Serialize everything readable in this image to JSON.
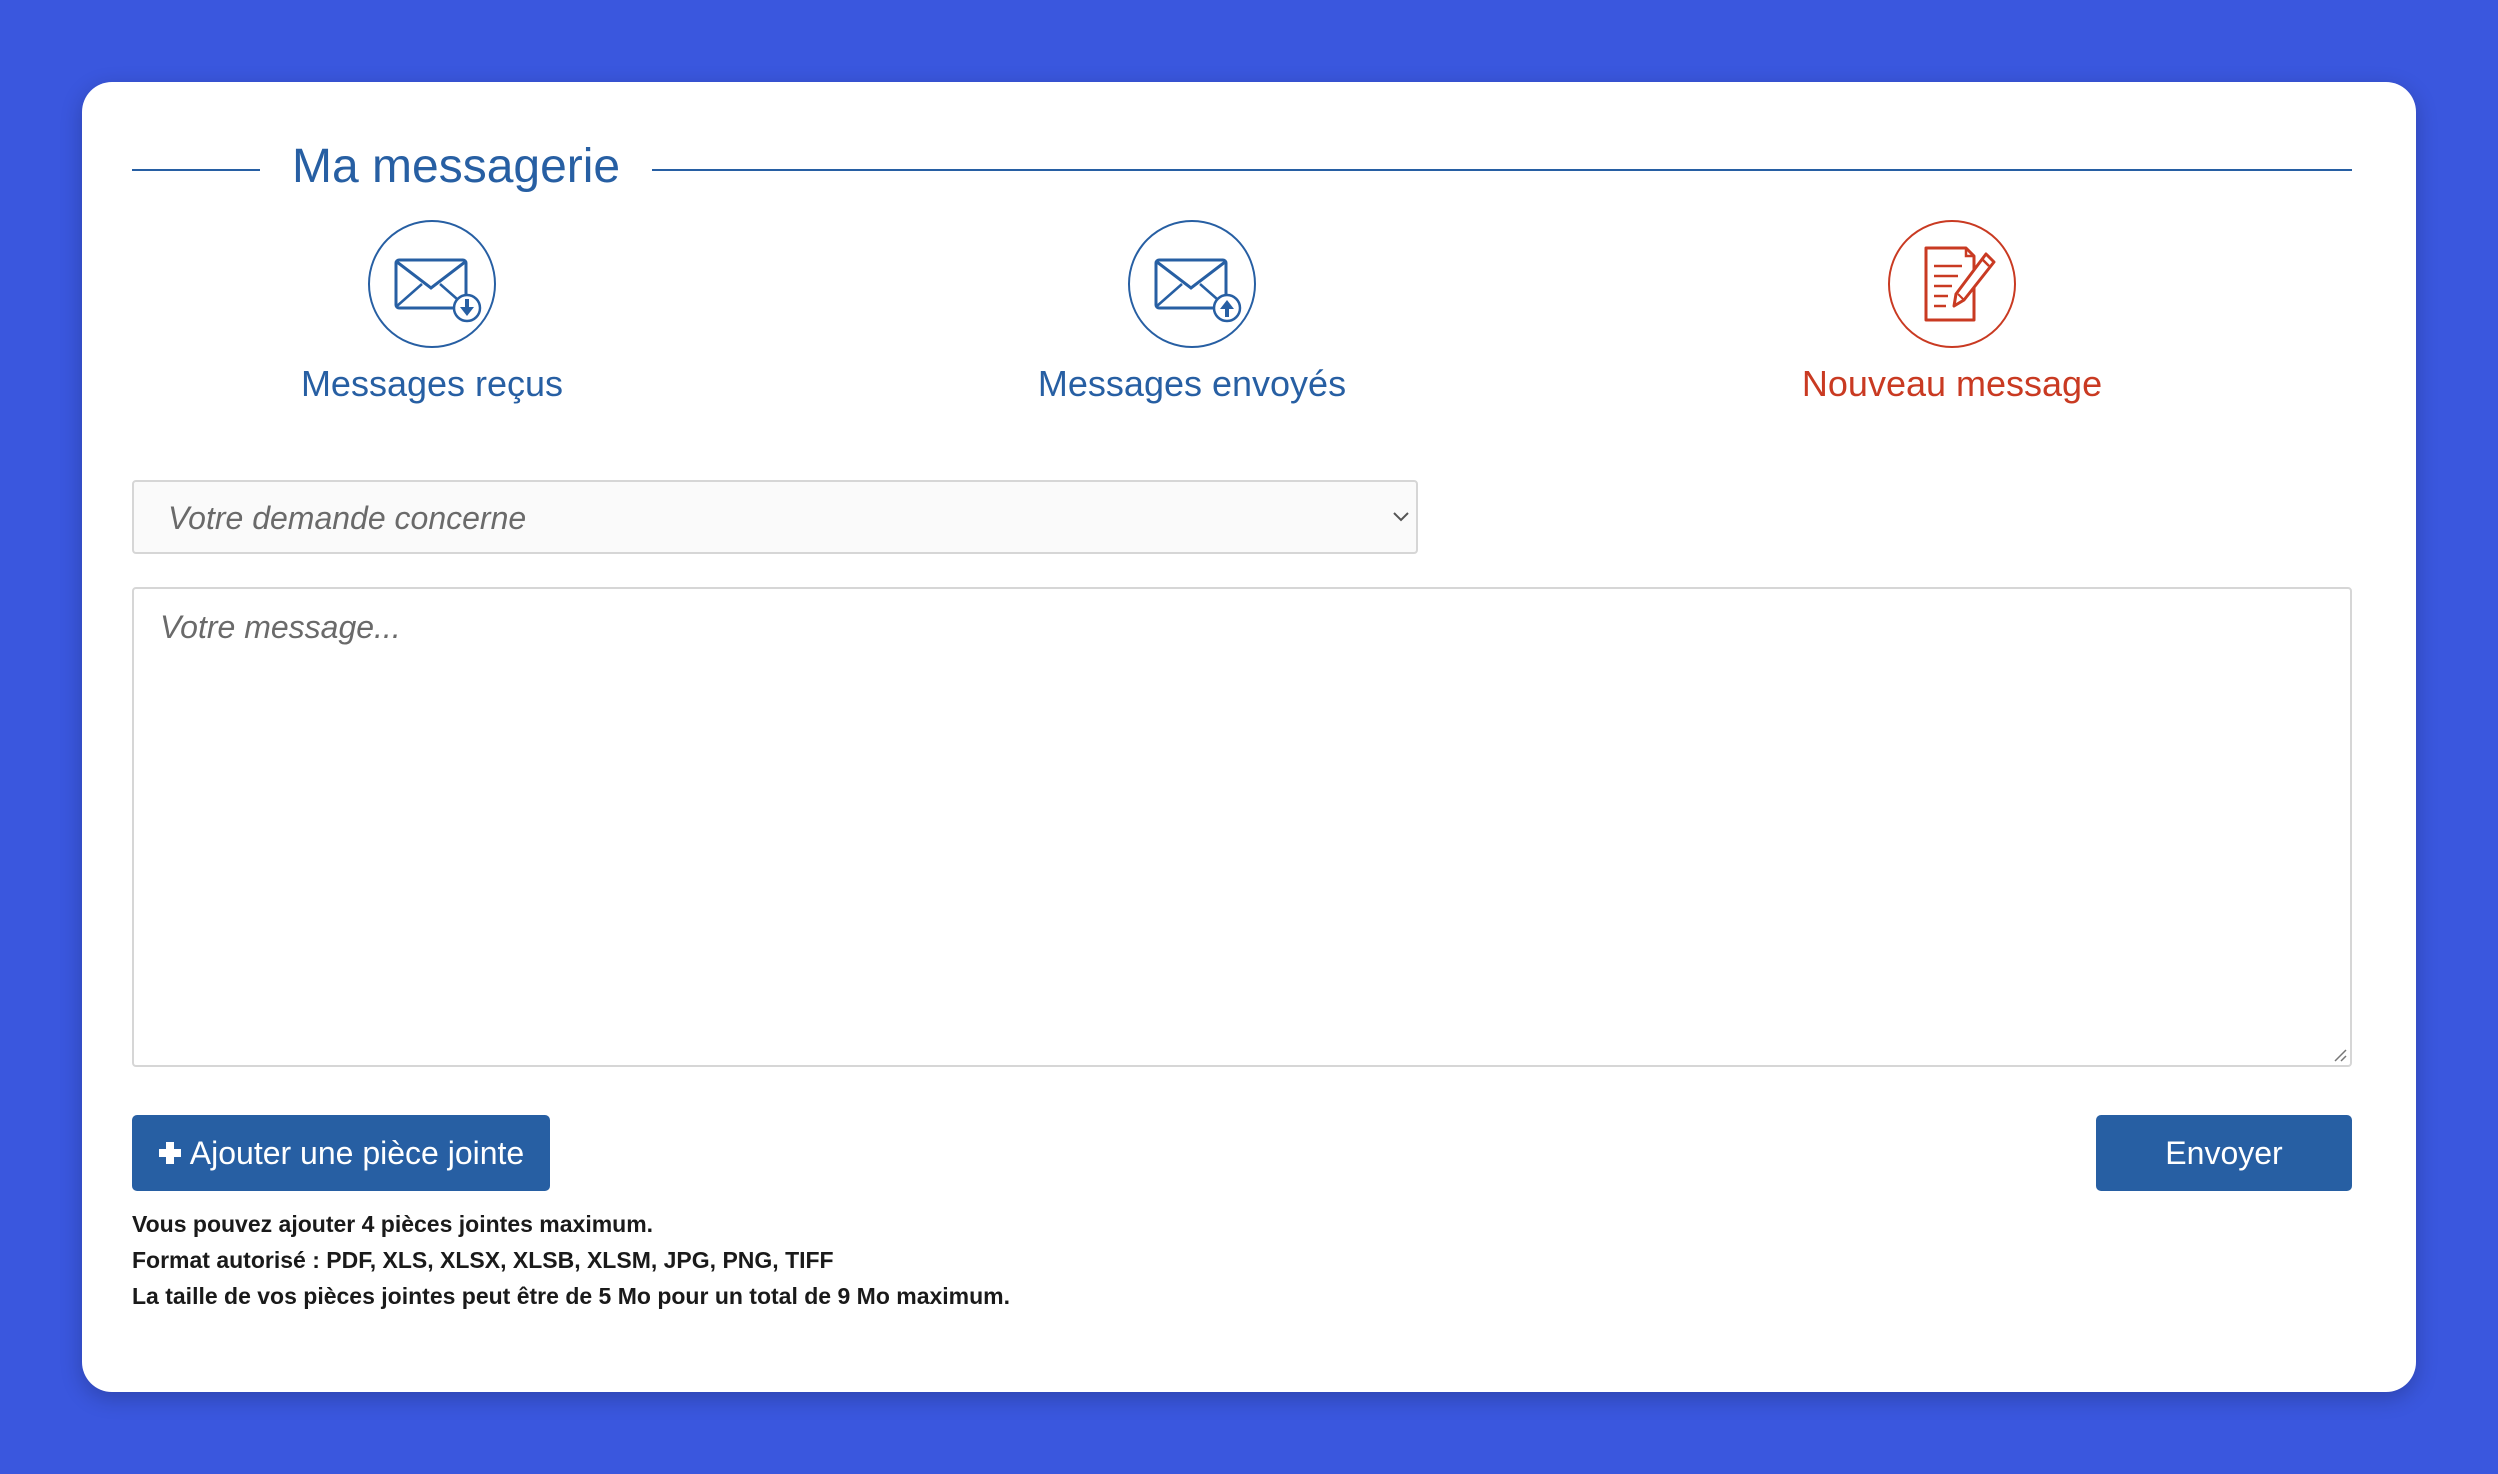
{
  "page": {
    "title": "Ma messagerie"
  },
  "tabs": [
    {
      "label": "Messages reçus",
      "icon": "envelope-download-icon",
      "active": false
    },
    {
      "label": "Messages envoyés",
      "icon": "envelope-upload-icon",
      "active": false
    },
    {
      "label": "Nouveau message",
      "icon": "document-pen-icon",
      "active": true
    }
  ],
  "form": {
    "subject_select": {
      "selected": "Votre demande concerne",
      "icon": "chevron-down-icon"
    },
    "message_input": {
      "placeholder": "Votre message..."
    },
    "attach_button": {
      "label": "Ajouter une pièce jointe",
      "icon": "plus-icon"
    },
    "send_button": {
      "label": "Envoyer"
    },
    "notes": [
      "Vous pouvez ajouter 4 pièces jointes maximum.",
      "Format autorisé : PDF, XLS, XLSX, XLSB, XLSM, JPG, PNG, TIFF",
      "La taille de vos pièces jointes peut être de 5 Mo pour un total de 9 Mo maximum."
    ]
  },
  "colors": {
    "background": "#3a57de",
    "primary": "#275fa3",
    "active": "#c93a22",
    "card": "#ffffff"
  }
}
